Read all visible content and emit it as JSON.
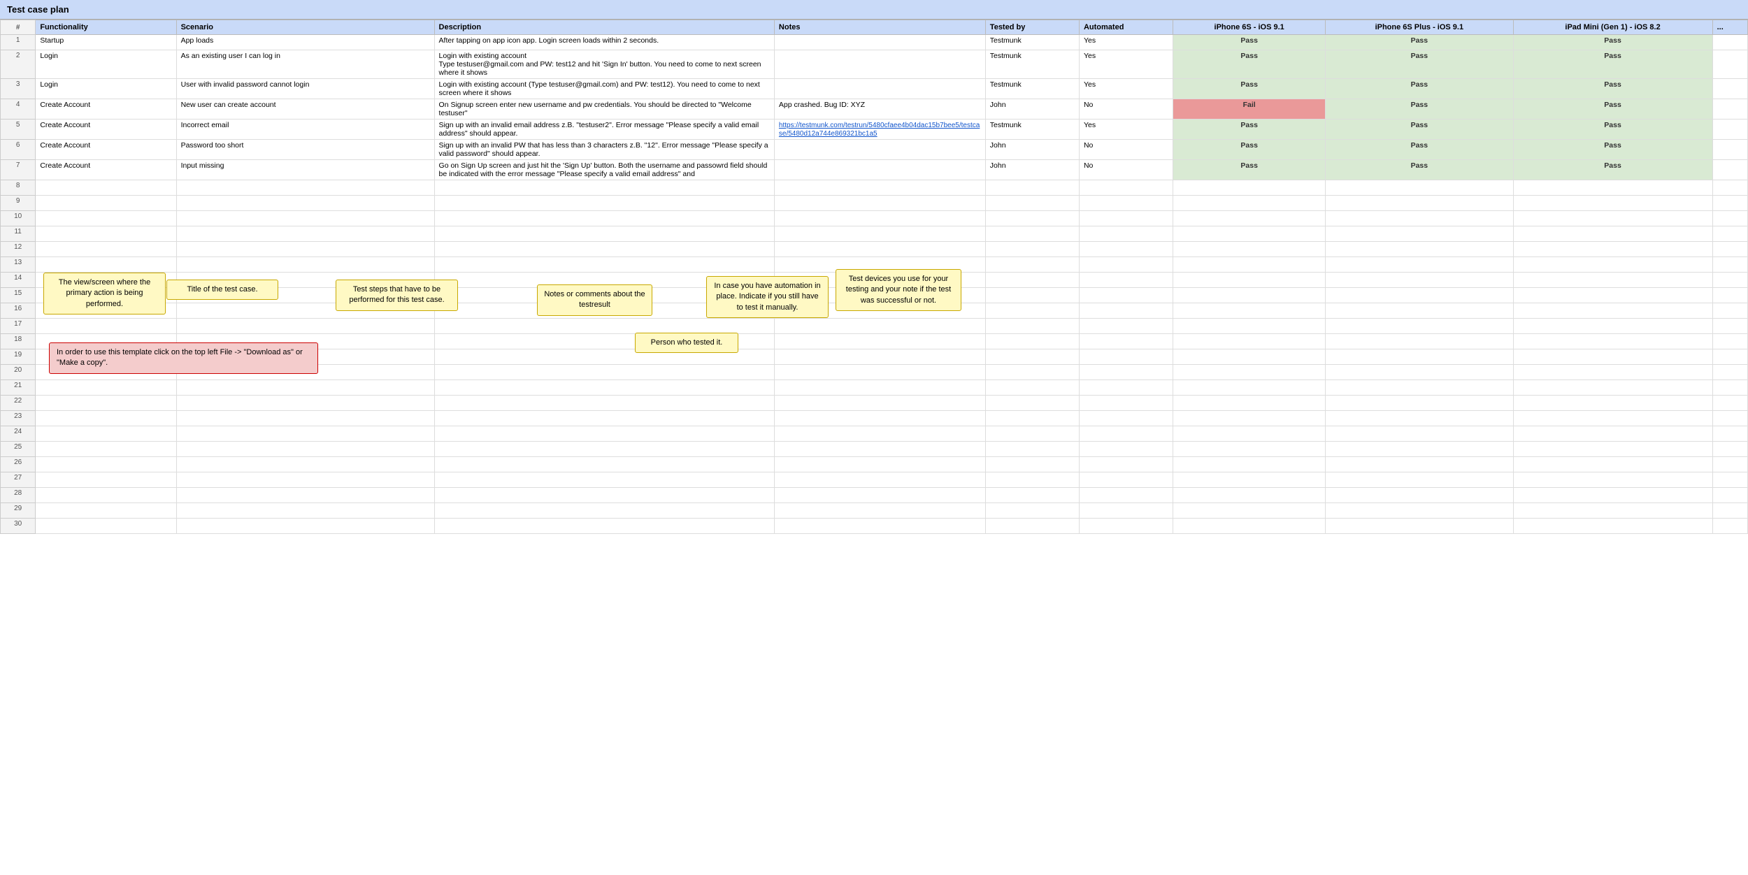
{
  "title": "Test case plan",
  "header": {
    "num": "#",
    "functionality": "Functionality",
    "scenario": "Scenario",
    "description": "Description",
    "notes": "Notes",
    "tested_by": "Tested by",
    "automated": "Automated",
    "iphone6s": "iPhone 6S - iOS 9.1",
    "iphone6splus": "iPhone 6S Plus - iOS 9.1",
    "ipadmini": "iPad Mini (Gen 1) - iOS 8.2",
    "more": "..."
  },
  "rows": [
    {
      "num": "1",
      "functionality": "Startup",
      "scenario": "App loads",
      "description": "After tapping on app icon app. Login screen loads within 2 seconds.",
      "notes": "",
      "tested_by": "Testmunk",
      "automated": "Yes",
      "iphone6s": "Pass",
      "iphone6splus": "Pass",
      "ipadmini": "Pass",
      "iphone6s_status": "pass",
      "iphone6splus_status": "pass",
      "ipadmini_status": "pass"
    },
    {
      "num": "2",
      "functionality": "Login",
      "scenario": "As an existing user I can log in",
      "description": "Login with existing account\nType testuser@gmail.com and PW: test12 and hit 'Sign In' button. You need to come to next screen where it shows",
      "notes": "",
      "tested_by": "Testmunk",
      "automated": "Yes",
      "iphone6s": "Pass",
      "iphone6splus": "Pass",
      "ipadmini": "Pass",
      "iphone6s_status": "pass",
      "iphone6splus_status": "pass",
      "ipadmini_status": "pass"
    },
    {
      "num": "3",
      "functionality": "Login",
      "scenario": "User with invalid password cannot login",
      "description": "Login with existing account (Type testuser@gmail.com) and PW: test12). You need to come to next screen where it shows",
      "notes": "",
      "tested_by": "Testmunk",
      "automated": "Yes",
      "iphone6s": "Pass",
      "iphone6splus": "Pass",
      "ipadmini": "Pass",
      "iphone6s_status": "pass",
      "iphone6splus_status": "pass",
      "ipadmini_status": "pass"
    },
    {
      "num": "4",
      "functionality": "Create Account",
      "scenario": "New user can create account",
      "description": "On Signup screen enter new username and pw credentials. You should be directed to \"Welcome testuser\"",
      "notes": "App crashed. Bug ID: XYZ",
      "tested_by": "John",
      "automated": "No",
      "iphone6s": "Fail",
      "iphone6splus": "Pass",
      "ipadmini": "Pass",
      "iphone6s_status": "fail",
      "iphone6splus_status": "pass",
      "ipadmini_status": "pass"
    },
    {
      "num": "5",
      "functionality": "Create Account",
      "scenario": "Incorrect email",
      "description": "Sign up with an invalid email address z.B. \"testuser2\". Error message \"Please specify a valid email address\" should appear.",
      "notes": "https://testmunk.com/testrun/5480cfaee4b04dac15b7bee5/testcase/5480d12a744e869321bc1a5",
      "tested_by": "Testmunk",
      "automated": "Yes",
      "iphone6s": "Pass",
      "iphone6splus": "Pass",
      "ipadmini": "Pass",
      "iphone6s_status": "pass",
      "iphone6splus_status": "pass",
      "ipadmini_status": "pass"
    },
    {
      "num": "6",
      "functionality": "Create Account",
      "scenario": "Password too short",
      "description": "Sign up with an invalid PW that has less than 3 characters z.B. \"12\". Error message \"Please specify a valid password\" should appear.",
      "notes": "",
      "tested_by": "John",
      "automated": "No",
      "iphone6s": "Pass",
      "iphone6splus": "Pass",
      "ipadmini": "Pass",
      "iphone6s_status": "pass",
      "iphone6splus_status": "pass",
      "ipadmini_status": "pass"
    },
    {
      "num": "7",
      "functionality": "Create Account",
      "scenario": "Input missing",
      "description": "Go on Sign Up screen and just hit the 'Sign Up' button. Both the username and passowrd field should be indicated with the error message \"Please specify a valid email address\" and",
      "notes": "",
      "tested_by": "John",
      "automated": "No",
      "iphone6s": "Pass",
      "iphone6splus": "Pass",
      "ipadmini": "Pass",
      "iphone6s_status": "pass",
      "iphone6splus_status": "pass",
      "ipadmini_status": "pass"
    }
  ],
  "empty_rows": [
    "8",
    "9",
    "10",
    "11",
    "12",
    "13",
    "14",
    "15",
    "16",
    "17",
    "18",
    "19",
    "20",
    "21",
    "22",
    "23",
    "24",
    "25",
    "26",
    "27",
    "28",
    "29",
    "30"
  ],
  "annotations": {
    "functionality_box": "The view/screen where the primary action is being performed.",
    "scenario_box": "Title of the test case.",
    "description_box": "Test steps that have to be performed for this test case.",
    "notes_box": "Notes or comments about the testresult",
    "tested_by_box": "Person who tested it.",
    "automated_box": "In case you have automation in place. Indicate if you still have to test it manually.",
    "devices_box": "Test devices you use for your testing and your note if the test was successful or not.",
    "red_box": "In order to use this template click on the top left File -> \"Download as\" or \"Make a copy\"."
  }
}
